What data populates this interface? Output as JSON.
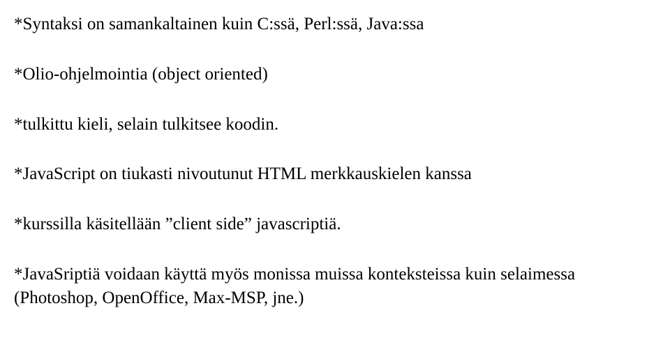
{
  "paragraphs": {
    "p1": "*Syntaksi on samankaltainen kuin C:ssä, Perl:ssä, Java:ssa",
    "p2": "*Olio-ohjelmointia (object oriented)",
    "p3": "*tulkittu kieli, selain tulkitsee koodin.",
    "p4": "*JavaScript on tiukasti nivoutunut HTML merkkauskielen kanssa",
    "p5": "*kurssilla käsitellään ”client side” javascriptiä.",
    "p6": "*JavaSriptiä voidaan käyttä myös monissa muissa konteksteissa kuin selaimessa (Photoshop, OpenOffice, Max-MSP, jne.)"
  }
}
